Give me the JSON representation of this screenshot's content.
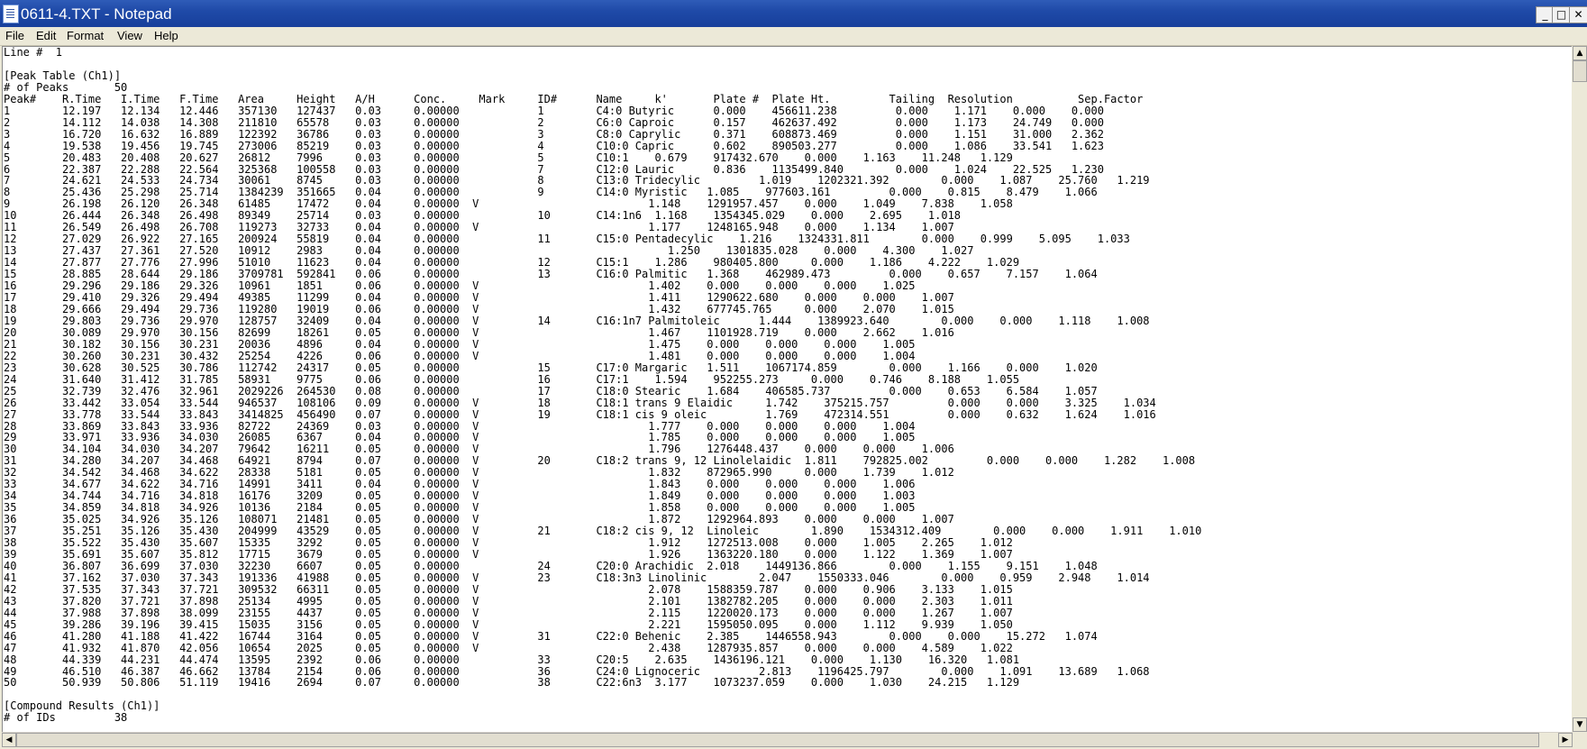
{
  "window": {
    "title": "0611-4.TXT - Notepad",
    "minimize_glyph": "_",
    "maximize_glyph": "□",
    "close_glyph": "✕"
  },
  "menu": {
    "file": "File",
    "edit": "Edit",
    "format": "Format",
    "view": "View",
    "help": "Help"
  },
  "scrollbar": {
    "up_glyph": "▲",
    "down_glyph": "▼",
    "left_glyph": "◀",
    "right_glyph": "▶"
  },
  "document": {
    "lines": [
      "Line #  1",
      "",
      "[Peak Table (Ch1)]",
      "# of Peaks       50",
      "Peak#    R.Time   I.Time   F.Time   Area     Height   A/H      Conc.     Mark     ID#      Name     k'       Plate #  Plate Ht.         Tailing  Resolution          Sep.Factor",
      "1        12.197   12.134   12.446   357130   127437   0.03     0.00000            1        C4:0 Butyric      0.000    456611.238         0.000    1.171    0.000    0.000",
      "2        14.112   14.038   14.308   211810   65578    0.03     0.00000            2        C6:0 Caproic      0.157    462637.492         0.000    1.173    24.749   0.000",
      "3        16.720   16.632   16.889   122392   36786    0.03     0.00000            3        C8:0 Caprylic     0.371    608873.469         0.000    1.151    31.000   2.362",
      "4        19.538   19.456   19.745   273006   85219    0.03     0.00000            4        C10:0 Capric      0.602    890503.277         0.000    1.086    33.541   1.623",
      "5        20.483   20.408   20.627   26812    7996     0.03     0.00000            5        C10:1    0.679    917432.670    0.000    1.163    11.248   1.129",
      "6        22.387   22.288   22.564   325368   100558   0.03     0.00000            7        C12:0 Lauric      0.836    1135499.840        0.000    1.024    22.525   1.230",
      "7        24.621   24.533   24.734   30061    8745     0.03     0.00000            8        C13:0 Tridecylic         1.019    1202321.392        0.000    1.087    25.760   1.219",
      "8        25.436   25.298   25.714   1384239  351665   0.04     0.00000            9        C14:0 Myristic   1.085    977603.161         0.000    0.815    8.479    1.066",
      "9        26.198   26.120   26.348   61485    17472    0.04     0.00000  V                          1.148    1291957.457    0.000    1.049    7.838    1.058",
      "10       26.444   26.348   26.498   89349    25714    0.03     0.00000            10       C14:1n6  1.168    1354345.029    0.000    2.695    1.018",
      "11       26.549   26.498   26.708   119273   32733    0.04     0.00000  V                          1.177    1248165.948    0.000    1.134    1.007",
      "12       27.029   26.922   27.165   200924   55819    0.04     0.00000            11       C15:0 Pentadecylic    1.216    1324331.811        0.000    0.999    5.095    1.033",
      "13       27.437   27.361   27.520   10912    2983     0.04     0.00000                                1.250    1301835.028    0.000    4.300    1.027",
      "14       27.877   27.776   27.996   51010    11623    0.04     0.00000            12       C15:1    1.286    980405.800     0.000    1.186    4.222    1.029",
      "15       28.885   28.644   29.186   3709781  592841   0.06     0.00000            13       C16:0 Palmitic   1.368    462989.473         0.000    0.657    7.157    1.064",
      "16       29.296   29.186   29.326   10961    1851     0.06     0.00000  V                          1.402    0.000    0.000    0.000    1.025",
      "17       29.410   29.326   29.494   49385    11299    0.04     0.00000  V                          1.411    1290622.680    0.000    0.000    1.007",
      "18       29.666   29.494   29.736   119280   19019    0.06     0.00000  V                          1.432    677745.765     0.000    2.070    1.015",
      "19       29.803   29.736   29.970   128757   32409    0.04     0.00000  V         14       C16:1n7 Palmitoleic      1.444    1389923.640        0.000    0.000    1.118    1.008",
      "20       30.089   29.970   30.156   82699    18261    0.05     0.00000  V                          1.467    1101928.719    0.000    2.662    1.016",
      "21       30.182   30.156   30.231   20036    4896     0.04     0.00000  V                          1.475    0.000    0.000    0.000    1.005",
      "22       30.260   30.231   30.432   25254    4226     0.06     0.00000  V                          1.481    0.000    0.000    0.000    1.004",
      "23       30.628   30.525   30.786   112742   24317    0.05     0.00000            15       C17:0 Margaric   1.511    1067174.859        0.000    1.166    0.000    1.020",
      "24       31.640   31.412   31.785   58931    9775     0.06     0.00000            16       C17:1    1.594    952255.273     0.000    0.746    8.188    1.055",
      "25       32.739   32.476   32.961   2029226  264530   0.08     0.00000            17       C18:0 Stearic    1.684    406585.737         0.000    0.653    6.584    1.057",
      "26       33.442   33.054   33.544   946537   108106   0.09     0.00000  V         18       C18:1 trans 9 Elaidic     1.742    375215.757         0.000    0.000    3.325    1.034",
      "27       33.778   33.544   33.843   3414825  456490   0.07     0.00000  V         19       C18:1 cis 9 oleic         1.769    472314.551         0.000    0.632    1.624    1.016",
      "28       33.869   33.843   33.936   82722    24369    0.03     0.00000  V                          1.777    0.000    0.000    0.000    1.004",
      "29       33.971   33.936   34.030   26085    6367     0.04     0.00000  V                          1.785    0.000    0.000    0.000    1.005",
      "30       34.104   34.030   34.207   79642    16211    0.05     0.00000  V                          1.796    1276448.437    0.000    0.000    1.006",
      "31       34.280   34.207   34.468   64921    8794     0.07     0.00000  V         20       C18:2 trans 9, 12 Linolelaidic  1.811    792825.002         0.000    0.000    1.282    1.008",
      "32       34.542   34.468   34.622   28338    5181     0.05     0.00000  V                          1.832    872965.990     0.000    1.739    1.012",
      "33       34.677   34.622   34.716   14991    3411     0.04     0.00000  V                          1.843    0.000    0.000    0.000    1.006",
      "34       34.744   34.716   34.818   16176    3209     0.05     0.00000  V                          1.849    0.000    0.000    0.000    1.003",
      "35       34.859   34.818   34.926   10136    2184     0.05     0.00000  V                          1.858    0.000    0.000    0.000    1.005",
      "36       35.025   34.926   35.126   108071   21481    0.05     0.00000  V                          1.872    1292964.893    0.000    0.000    1.007",
      "37       35.251   35.126   35.430   204999   43529    0.05     0.00000  V         21       C18:2 cis 9, 12  Linoleic        1.890    1534312.409        0.000    0.000    1.911    1.010",
      "38       35.522   35.430   35.607   15335    3292     0.05     0.00000  V                          1.912    1272513.008    0.000    1.005    2.265    1.012",
      "39       35.691   35.607   35.812   17715    3679     0.05     0.00000  V                          1.926    1363220.180    0.000    1.122    1.369    1.007",
      "40       36.807   36.699   37.030   32230    6607     0.05     0.00000            24       C20:0 Arachidic  2.018    1449136.866        0.000    1.155    9.151    1.048",
      "41       37.162   37.030   37.343   191336   41988    0.05     0.00000  V         23       C18:3n3 Linolinic        2.047    1550333.046        0.000    0.959    2.948    1.014",
      "42       37.535   37.343   37.721   309532   66311    0.05     0.00000  V                          2.078    1588359.787    0.000    0.906    3.133    1.015",
      "43       37.820   37.721   37.898   25134    4995     0.05     0.00000  V                          2.101    1382782.205    0.000    0.000    2.303    1.011",
      "44       37.988   37.898   38.099   23155    4437     0.05     0.00000  V                          2.115    1220020.173    0.000    0.000    1.267    1.007",
      "45       39.286   39.196   39.415   15035    3156     0.05     0.00000  V                          2.221    1595050.095    0.000    1.112    9.939    1.050",
      "46       41.280   41.188   41.422   16744    3164     0.05     0.00000  V         31       C22:0 Behenic    2.385    1446558.943        0.000    0.000    15.272   1.074",
      "47       41.932   41.870   42.056   10654    2025     0.05     0.00000  V                          2.438    1287935.857    0.000    0.000    4.589    1.022",
      "48       44.339   44.231   44.474   13595    2392     0.06     0.00000            33       C20:5    2.635    1436196.121    0.000    1.130    16.320   1.081",
      "49       46.510   46.387   46.662   13784    2154     0.06     0.00000            36       C24:0 Lignoceric         2.813    1196425.797        0.000    1.091    13.689   1.068",
      "50       50.939   50.806   51.119   19416    2694     0.07     0.00000            38       C22:6n3  3.177    1073237.059    0.000    1.030    24.215   1.129",
      "",
      "[Compound Results (Ch1)]",
      "# of IDs         38"
    ]
  }
}
